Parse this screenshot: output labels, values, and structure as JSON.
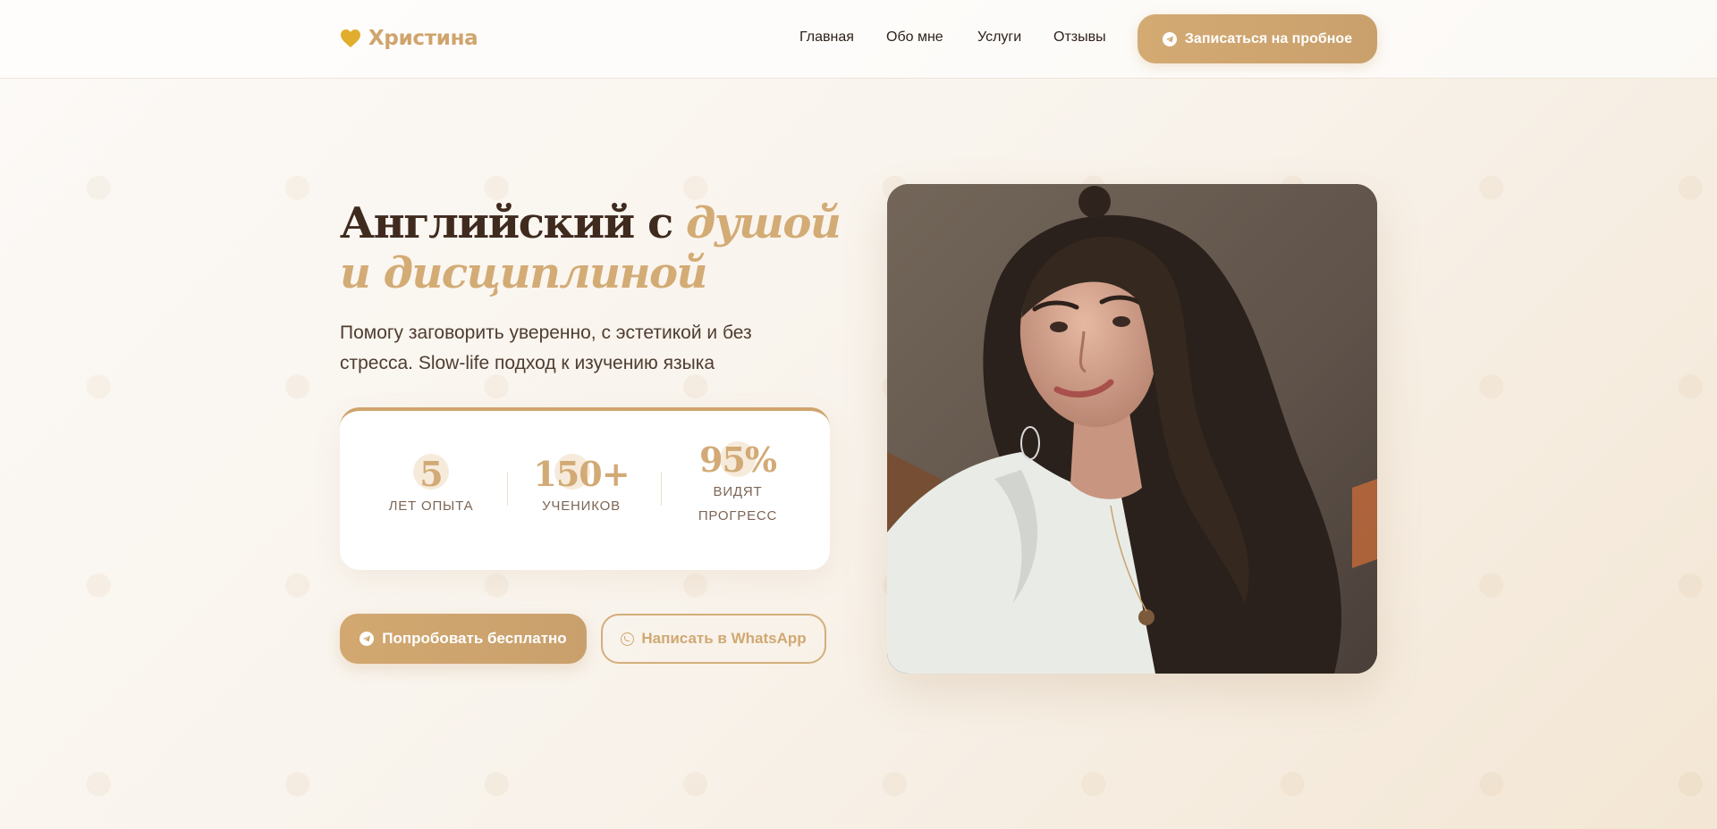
{
  "header": {
    "logo_text": "Христина",
    "nav": [
      "Главная",
      "Обо мне",
      "Услуги",
      "Отзывы"
    ],
    "cta_label": "Записаться на пробное"
  },
  "hero": {
    "title_plain": "Английский с ",
    "title_accent": "душой и дисциплиной",
    "subtitle": "Помогу заговорить уверенно, с эстетикой и без стресса. Slow-life подход к изучению языка",
    "stats": [
      {
        "value": "5",
        "label": "ЛЕТ ОПЫТА"
      },
      {
        "value": "150+",
        "label": "УЧЕНИКОВ"
      },
      {
        "value": "95%",
        "label_line1": "ВИДЯТ",
        "label_line2": "ПРОГРЕСС"
      }
    ],
    "primary_button": "Попробовать бесплатно",
    "secondary_button": "Написать в WhatsApp"
  },
  "colors": {
    "accent": "#cfa46c",
    "heading": "#3f2a1e",
    "text": "#4f3d31"
  },
  "icons": {
    "logo": "heart-icon",
    "cta": "telegram-icon",
    "secondary": "whatsapp-icon"
  }
}
